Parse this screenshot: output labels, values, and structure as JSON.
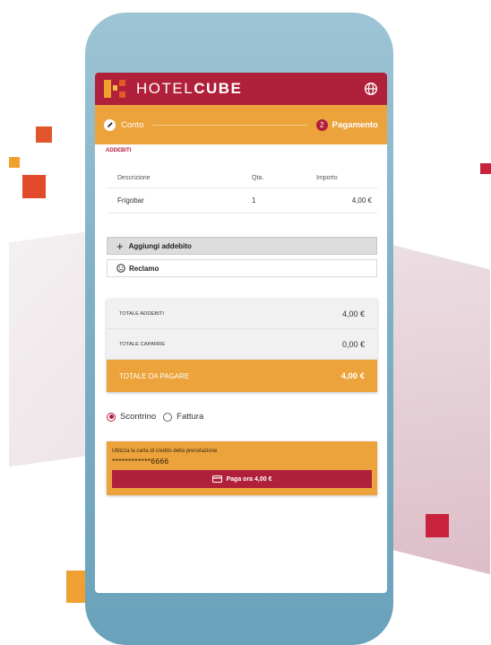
{
  "app": {
    "brand_light": "HOTEL",
    "brand_bold": "CUBE",
    "language_icon": "globe-icon"
  },
  "stepper": {
    "step1_label": "Conto",
    "step2_number": "2",
    "step2_label": "Pagamento"
  },
  "charges": {
    "section_title": "ADDEBITI",
    "headers": [
      "Descrizione",
      "Qta.",
      "Importo"
    ],
    "rows": [
      {
        "description": "Frigobar",
        "qty": "1",
        "amount": "4,00 €"
      }
    ]
  },
  "actions": {
    "add_charge": "Aggiungi addebito",
    "claim": "Reclamo"
  },
  "totals": {
    "charges_label": "TOTALE ADDEBITI",
    "charges_value": "4,00 €",
    "deposits_label": "TOTALE CAPARRE",
    "deposits_value": "0,00 €",
    "due_label": "TOTALE DA PAGARE",
    "due_value": "4,00 €"
  },
  "document_type": {
    "options": [
      "Scontrino",
      "Fattura"
    ],
    "selected": "Scontrino"
  },
  "payment": {
    "hint": "Utilizza la carta di credito della prenotazione",
    "card_number": "************6666",
    "pay_button": "Paga ora 4,00 €"
  },
  "colors": {
    "brand_red": "#b0203a",
    "accent_orange": "#eca33b",
    "phone_blue": "#7fb0c6"
  }
}
